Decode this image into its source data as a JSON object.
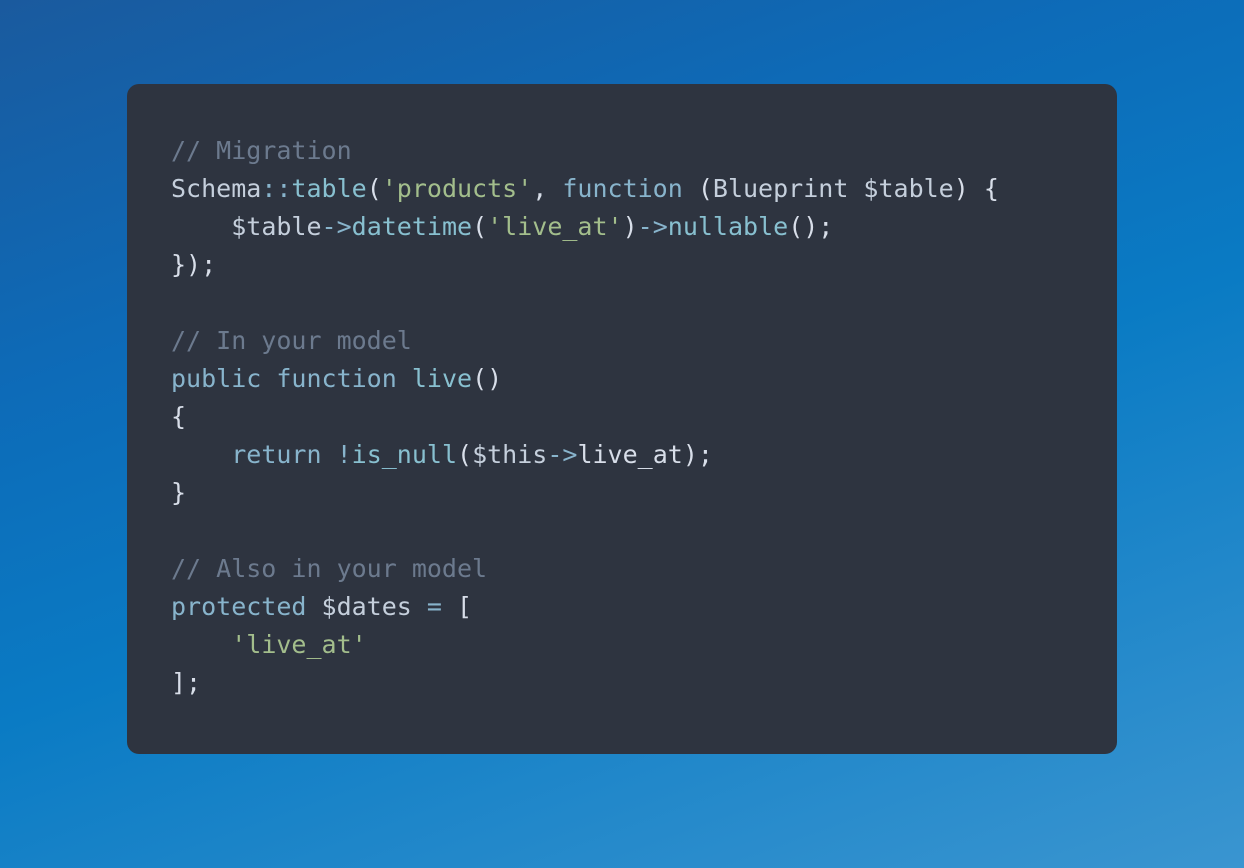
{
  "code": {
    "lines": [
      {
        "segments": [
          {
            "text": "// Migration",
            "class": "comment"
          }
        ]
      },
      {
        "segments": [
          {
            "text": "Schema",
            "class": "class-name"
          },
          {
            "text": "::",
            "class": "operator"
          },
          {
            "text": "table",
            "class": "method"
          },
          {
            "text": "(",
            "class": "punctuation"
          },
          {
            "text": "'products'",
            "class": "string"
          },
          {
            "text": ", ",
            "class": "punctuation"
          },
          {
            "text": "function",
            "class": "keyword"
          },
          {
            "text": " (",
            "class": "punctuation"
          },
          {
            "text": "Blueprint ",
            "class": "class-name"
          },
          {
            "text": "$table",
            "class": "variable"
          },
          {
            "text": ") {",
            "class": "punctuation"
          }
        ]
      },
      {
        "segments": [
          {
            "text": "    ",
            "class": "punctuation"
          },
          {
            "text": "$table",
            "class": "variable"
          },
          {
            "text": "->",
            "class": "operator"
          },
          {
            "text": "datetime",
            "class": "method"
          },
          {
            "text": "(",
            "class": "punctuation"
          },
          {
            "text": "'live_at'",
            "class": "string"
          },
          {
            "text": ")",
            "class": "punctuation"
          },
          {
            "text": "->",
            "class": "operator"
          },
          {
            "text": "nullable",
            "class": "method"
          },
          {
            "text": "();",
            "class": "punctuation"
          }
        ]
      },
      {
        "segments": [
          {
            "text": "});",
            "class": "punctuation"
          }
        ]
      },
      {
        "segments": [
          {
            "text": "",
            "class": "punctuation"
          }
        ]
      },
      {
        "segments": [
          {
            "text": "// In your model",
            "class": "comment"
          }
        ]
      },
      {
        "segments": [
          {
            "text": "public",
            "class": "keyword"
          },
          {
            "text": " ",
            "class": "punctuation"
          },
          {
            "text": "function",
            "class": "keyword"
          },
          {
            "text": " ",
            "class": "punctuation"
          },
          {
            "text": "live",
            "class": "method"
          },
          {
            "text": "()",
            "class": "punctuation"
          }
        ]
      },
      {
        "segments": [
          {
            "text": "{",
            "class": "punctuation"
          }
        ]
      },
      {
        "segments": [
          {
            "text": "    ",
            "class": "punctuation"
          },
          {
            "text": "return",
            "class": "keyword"
          },
          {
            "text": " ",
            "class": "punctuation"
          },
          {
            "text": "!",
            "class": "operator"
          },
          {
            "text": "is_null",
            "class": "method"
          },
          {
            "text": "(",
            "class": "punctuation"
          },
          {
            "text": "$this",
            "class": "variable"
          },
          {
            "text": "->",
            "class": "operator"
          },
          {
            "text": "live_at",
            "class": "function-name"
          },
          {
            "text": ");",
            "class": "punctuation"
          }
        ]
      },
      {
        "segments": [
          {
            "text": "}",
            "class": "punctuation"
          }
        ]
      },
      {
        "segments": [
          {
            "text": "",
            "class": "punctuation"
          }
        ]
      },
      {
        "segments": [
          {
            "text": "// Also in your model",
            "class": "comment"
          }
        ]
      },
      {
        "segments": [
          {
            "text": "protected",
            "class": "keyword"
          },
          {
            "text": " ",
            "class": "punctuation"
          },
          {
            "text": "$dates",
            "class": "variable"
          },
          {
            "text": " ",
            "class": "punctuation"
          },
          {
            "text": "=",
            "class": "operator"
          },
          {
            "text": " [",
            "class": "punctuation"
          }
        ]
      },
      {
        "segments": [
          {
            "text": "    ",
            "class": "punctuation"
          },
          {
            "text": "'live_at'",
            "class": "string"
          }
        ]
      },
      {
        "segments": [
          {
            "text": "];",
            "class": "punctuation"
          }
        ]
      }
    ]
  }
}
